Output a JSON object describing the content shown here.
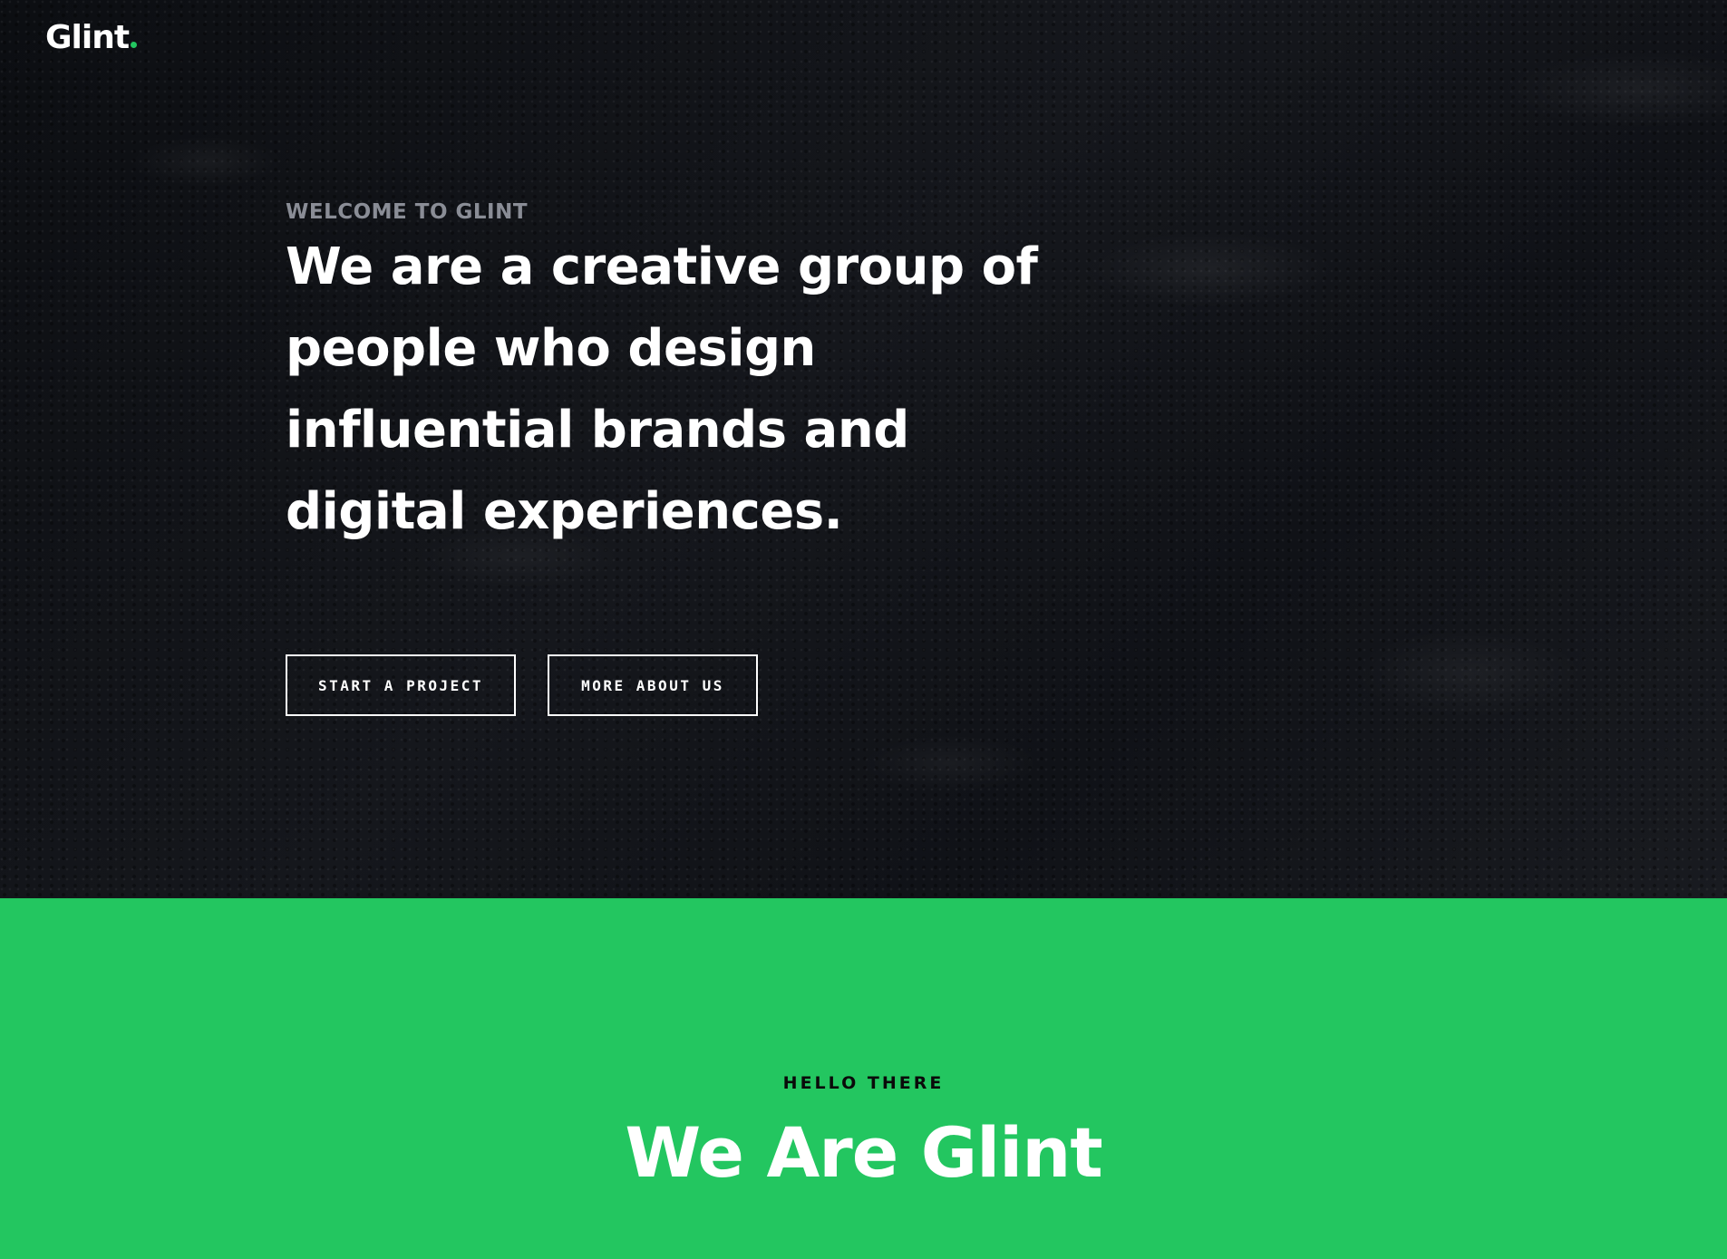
{
  "colors": {
    "accent": "#23c660",
    "hero_background": "#101216",
    "text_primary": "#ffffff",
    "text_muted": "#8a8d96",
    "text_dark": "#0a0a0a"
  },
  "header": {
    "logo_text": "Glint",
    "logo_dot_color": "#23c660"
  },
  "hero": {
    "kicker": "WELCOME TO GLINT",
    "headline": "We are a creative group of people who design influential brands and digital experiences.",
    "buttons": [
      {
        "label": "START A PROJECT"
      },
      {
        "label": "MORE ABOUT US"
      }
    ]
  },
  "about": {
    "kicker": "HELLO THERE",
    "title": "We Are Glint"
  }
}
